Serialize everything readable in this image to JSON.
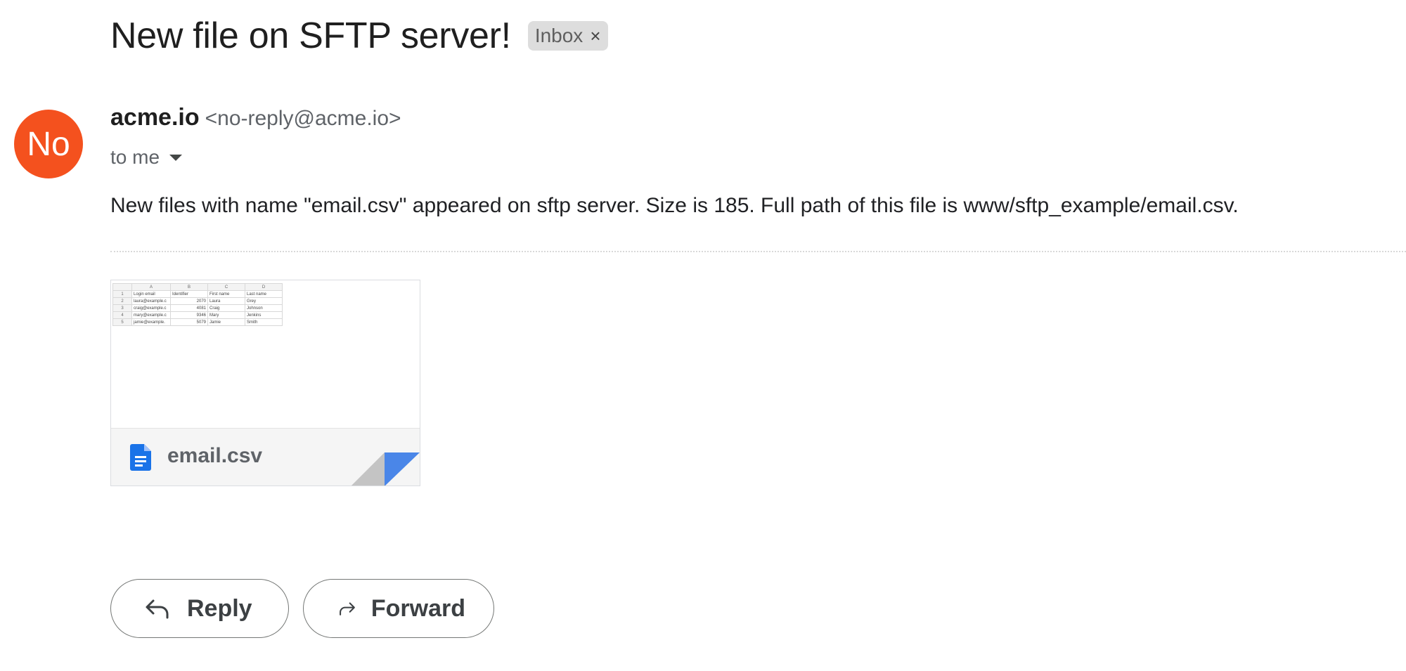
{
  "email": {
    "subject": "New file on SFTP server!",
    "label": "Inbox",
    "label_remove_glyph": "×",
    "avatar_initials": "No",
    "avatar_color": "#f4511e",
    "sender_name": "acme.io",
    "sender_address": "<no-reply@acme.io>",
    "recipient": "to me",
    "body": "New files with name \"email.csv\" appeared on sftp server. Size is 185. Full path of this file is www/sftp_example/email.csv."
  },
  "attachment": {
    "file_name": "email.csv",
    "file_icon": "docs-file-icon",
    "icon_color": "#1a73e8",
    "preview": {
      "columns": [
        "A",
        "B",
        "C",
        "D"
      ],
      "rows": [
        [
          "1",
          "Login email",
          "Identifier",
          "First name",
          "Last name"
        ],
        [
          "2",
          "laura@example.c",
          "2070",
          "Laura",
          "Grey"
        ],
        [
          "3",
          "craig@example.c",
          "4081",
          "Craig",
          "Johnson"
        ],
        [
          "4",
          "mary@example.c",
          "9346",
          "Mary",
          "Jenkins"
        ],
        [
          "5",
          "jamie@example.",
          "5079",
          "Jamie",
          "Smith"
        ]
      ]
    }
  },
  "actions": {
    "reply_label": "Reply",
    "forward_label": "Forward",
    "reply_icon": "reply-arrow-icon",
    "forward_icon": "forward-arrow-icon"
  }
}
